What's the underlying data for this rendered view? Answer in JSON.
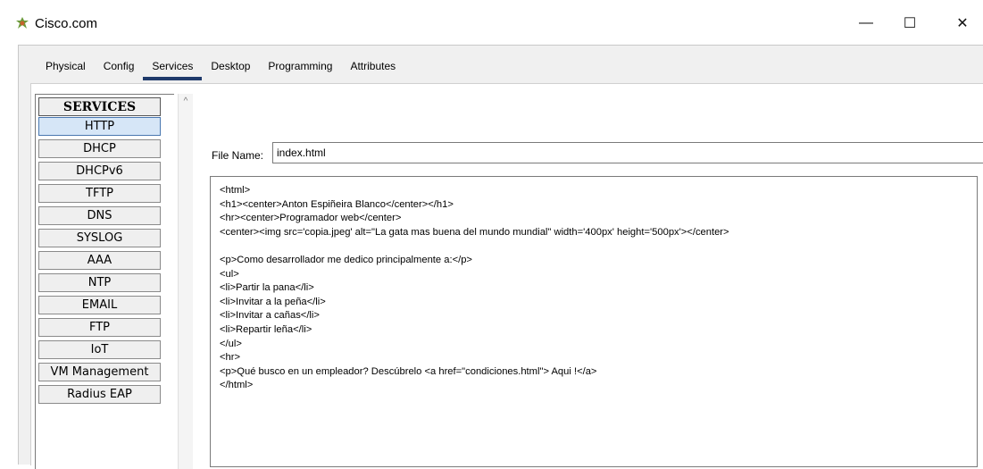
{
  "window": {
    "title": "Cisco.com",
    "icon": "cisco-app-icon"
  },
  "controls": {
    "minimize": "—",
    "maximize": "☐",
    "close": "✕"
  },
  "tabs": [
    {
      "label": "Physical",
      "active": false
    },
    {
      "label": "Config",
      "active": false
    },
    {
      "label": "Services",
      "active": true
    },
    {
      "label": "Desktop",
      "active": false
    },
    {
      "label": "Programming",
      "active": false
    },
    {
      "label": "Attributes",
      "active": false
    }
  ],
  "services": {
    "header": "SERVICES",
    "items": [
      "HTTP",
      "DHCP",
      "DHCPv6",
      "TFTP",
      "DNS",
      "SYSLOG",
      "AAA",
      "NTP",
      "EMAIL",
      "FTP",
      "IoT",
      "VM Management",
      "Radius EAP"
    ],
    "selected": "HTTP"
  },
  "file": {
    "label": "File Name:",
    "value": "index.html"
  },
  "editor": {
    "lines": [
      "<html>",
      "<h1><center>Anton Espiñeira Blanco</center></h1>",
      "<hr><center>Programador web</center>",
      "<center><img src='copia.jpeg' alt=\"La gata mas buena del mundo mundial\" width='400px' height='500px'></center>",
      "",
      "<p>Como desarrollador me dedico principalmente a:</p>",
      "<ul>",
      "<li>Partir la pana</li>",
      "<li>Invitar a la peña</li>",
      "<li>Invitar a cañas</li>",
      "<li>Repartir leña</li>",
      "</ul>",
      "<hr>",
      "<p>Qué busco en un empleador? Descúbrelo <a href=\"condiciones.html\"> Aqui !</a>",
      "</html>"
    ]
  },
  "colors": {
    "selected_bg": "#d6e6f7",
    "tab_underline": "#1f3a6b",
    "panel_bg": "#f0f0f0"
  }
}
